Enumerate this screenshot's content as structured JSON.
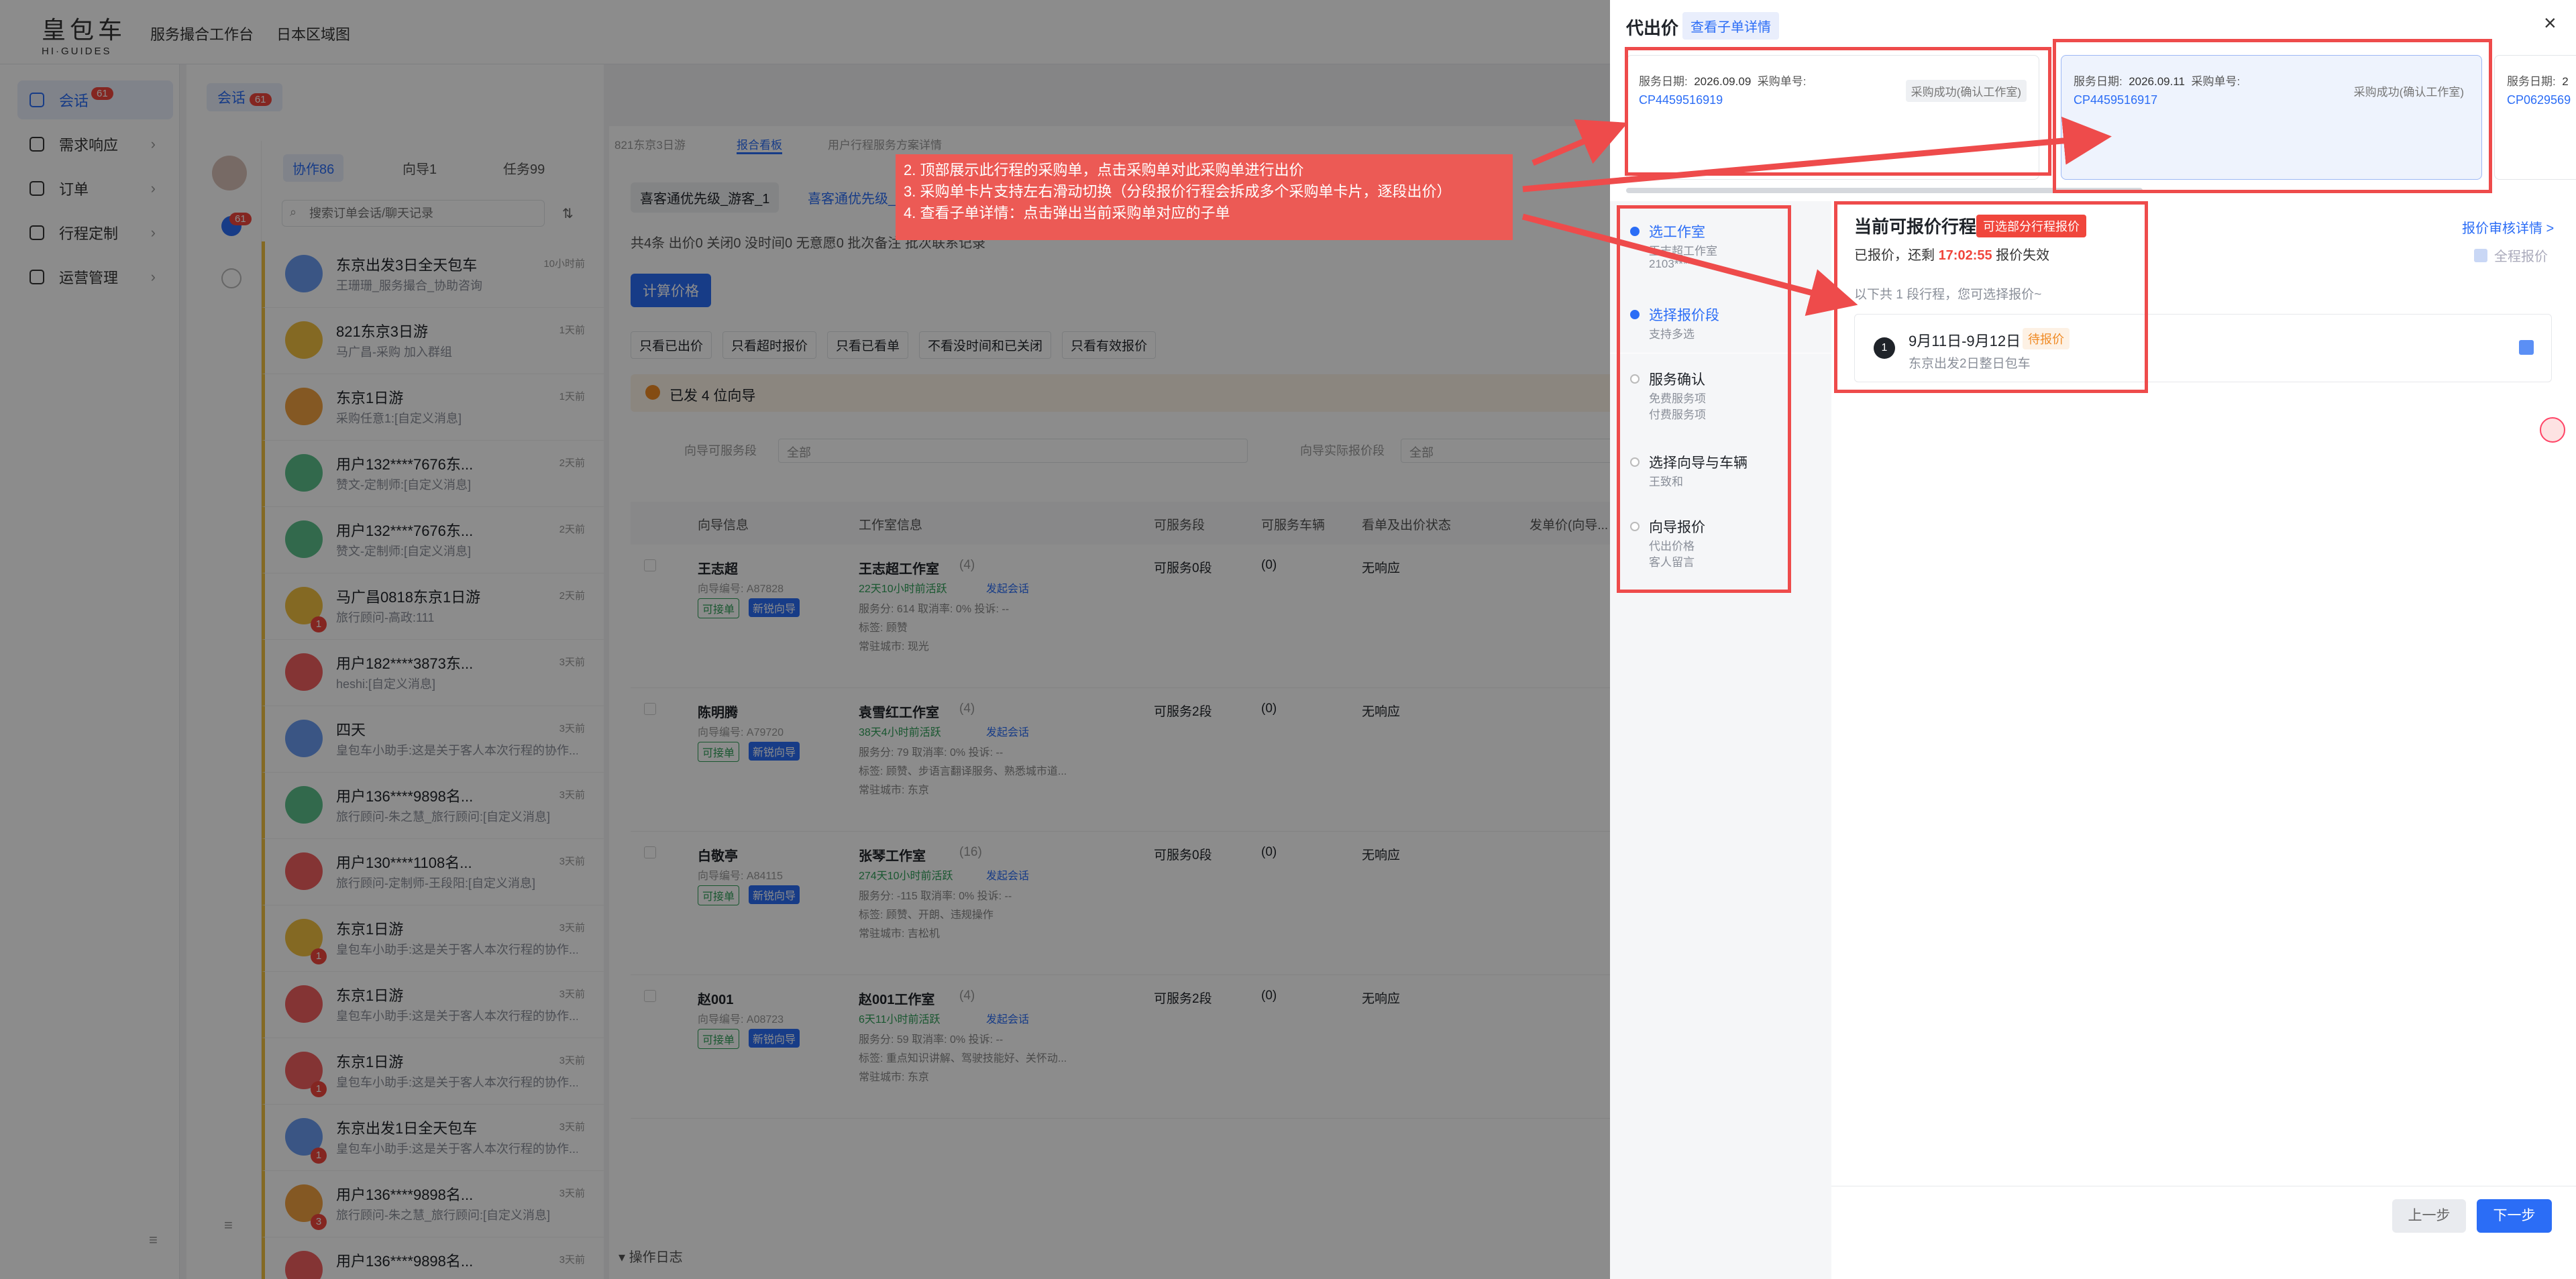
{
  "app": {
    "logo_cn": "皇包车",
    "logo_en": "HI·GUIDES",
    "top_nav": [
      "服务撮合工作台",
      "日本区域图"
    ]
  },
  "sidebar": {
    "items": [
      {
        "label": "会话",
        "badge": "61"
      },
      {
        "label": "需求响应"
      },
      {
        "label": "订单"
      },
      {
        "label": "行程定制"
      },
      {
        "label": "运营管理"
      }
    ]
  },
  "conversation": {
    "tab_label": "会话",
    "tab_badge": "61",
    "filters": [
      "协作86",
      "向导1",
      "任务99"
    ],
    "search_placeholder": "搜索订单会话/聊天记录",
    "rail_badge": "61",
    "chats": [
      {
        "name": "东京出发3日全天包车",
        "sub": "王珊珊_服务撮合_协助咨询",
        "time": "10小时前"
      },
      {
        "name": "821东京3日游",
        "sub": "马广昌-采购 加入群组",
        "time": "1天前"
      },
      {
        "name": "东京1日游",
        "sub": "采购任意1:[自定义消息]",
        "time": "1天前"
      },
      {
        "name": "用户132****7676东...",
        "sub": "赞文-定制师:[自定义消息]",
        "time": "2天前"
      },
      {
        "name": "用户132****7676东...",
        "sub": "赞文-定制师:[自定义消息]",
        "time": "2天前"
      },
      {
        "name": "马广昌0818东京1日游",
        "sub": "旅行顾问-高政:111",
        "time": "2天前",
        "badge": "1"
      },
      {
        "name": "用户182****3873东...",
        "sub": "heshi:[自定义消息]",
        "time": "3天前"
      },
      {
        "name": "四天",
        "sub": "皇包车小助手:这是关于客人本次行程的协作...",
        "time": "3天前"
      },
      {
        "name": "用户136****9898名...",
        "sub": "旅行顾问-朱之慧_旅行顾问:[自定义消息]",
        "time": "3天前"
      },
      {
        "name": "用户130****1108名...",
        "sub": "旅行顾问-定制师-王段阳:[自定义消息]",
        "time": "3天前"
      },
      {
        "name": "东京1日游",
        "sub": "皇包车小助手:这是关于客人本次行程的协作...",
        "time": "3天前",
        "badge": "1"
      },
      {
        "name": "东京1日游",
        "sub": "皇包车小助手:这是关于客人本次行程的协作...",
        "time": "3天前"
      },
      {
        "name": "东京1日游",
        "sub": "皇包车小助手:这是关于客人本次行程的协作...",
        "time": "3天前",
        "badge": "1"
      },
      {
        "name": "东京出发1日全天包车",
        "sub": "皇包车小助手:这是关于客人本次行程的协作...",
        "time": "3天前",
        "badge": "1"
      },
      {
        "name": "用户136****9898名...",
        "sub": "旅行顾问-朱之慧_旅行顾问:[自定义消息]",
        "time": "3天前",
        "badge": "3"
      },
      {
        "name": "用户136****9898名...",
        "sub": "",
        "time": "3天前"
      }
    ]
  },
  "main": {
    "breadcrumbs": [
      "821东京3日游",
      "报合看板",
      "用户行程服务方案详情"
    ],
    "tabs": [
      "喜客通优先级_游客_1",
      "喜客通优先级_1"
    ],
    "stats": "共4条  出价0  关闭0  没时间0  无意愿0  批次备注  批次联系记录",
    "calc_button": "计算价格",
    "filters": [
      "只看已出价",
      "只看超时报价",
      "只看已看单",
      "不看没时间和已关闭",
      "只看有效报价"
    ],
    "notice": "已发 4 位向导",
    "select_label_1": "向导可服务段",
    "select_value_1": "全部",
    "select_label_2": "向导实际报价段",
    "select_value_2": "全部",
    "columns": [
      "向导信息",
      "工作室信息",
      "可服务段",
      "可服务车辆",
      "看单及出价状态",
      "发单价(向导..."
    ],
    "rows": [
      {
        "guide": "王志超",
        "guide_no": "向导编号: A87828",
        "studio": "王志超工作室",
        "studio_count": "(4)",
        "online": "22天10小时前活跃",
        "chat": "发起会话",
        "stats": "服务分: 614  取消率: 0%  投诉: --",
        "tags": "标签: 顾赞",
        "city": "常驻城市: 现光",
        "segments": "可服务0段",
        "vehicles": "(0)",
        "status": "无响应"
      },
      {
        "guide": "陈明腾",
        "guide_no": "向导编号: A79720",
        "studio": "袁雪红工作室",
        "studio_count": "(4)",
        "online": "38天4小时前活跃",
        "chat": "发起会话",
        "stats": "服务分: 79  取消率: 0%  投诉: --",
        "tags": "标签: 顾赞、步语言翻译服务、熟悉城市道...",
        "city": "常驻城市: 东京",
        "segments": "可服务2段",
        "vehicles": "(0)",
        "status": "无响应"
      },
      {
        "guide": "白敬亭",
        "guide_no": "向导编号: A84115",
        "studio": "张琴工作室",
        "studio_count": "(16)",
        "online": "274天10小时前活跃",
        "chat": "发起会话",
        "stats": "服务分: -115  取消率: 0%  投诉: --",
        "tags": "标签: 顾赞、开朗、违规操作",
        "city": "常驻城市: 吉松机",
        "segments": "可服务0段",
        "vehicles": "(0)",
        "status": "无响应"
      },
      {
        "guide": "赵001",
        "guide_no": "向导编号: A08723",
        "studio": "赵001工作室",
        "studio_count": "(4)",
        "online": "6天11小时前活跃",
        "chat": "发起会话",
        "stats": "服务分: 59  取消率: 0%  投诉: --",
        "tags": "标签: 重点知识讲解、驾驶技能好、关怀动...",
        "city": "常驻城市: 东京",
        "segments": "可服务2段",
        "vehicles": "(0)",
        "status": "无响应"
      }
    ],
    "chip_accept": "可接单",
    "chip_new": "新锐向导",
    "log_label": "操作日志"
  },
  "drawer": {
    "title": "代出价",
    "sub_link": "查看子单详情",
    "purchase_cards": [
      {
        "date_label": "服务日期:",
        "date": "2026.09.09",
        "no_label": "采购单号:",
        "no": "CP4459516919",
        "status": "采购成功(确认工作室)"
      },
      {
        "date_label": "服务日期:",
        "date": "2026.09.11",
        "no_label": "采购单号:",
        "no": "CP4459516917",
        "status": "采购成功(确认工作室)"
      },
      {
        "date_label": "服务日期:",
        "date": "2",
        "no_label": "",
        "no": "CP0629569",
        "status": ""
      }
    ],
    "steps": [
      {
        "title": "选工作室",
        "subs": [
          "王志超工作室",
          "2103****"
        ]
      },
      {
        "title": "选择报价段",
        "subs": [
          "支持多选"
        ]
      },
      {
        "title": "服务确认",
        "subs": [
          "免费服务项",
          "付费服务项"
        ]
      },
      {
        "title": "选择向导与车辆",
        "subs": [
          "王致和"
        ]
      },
      {
        "title": "向导报价",
        "subs": [
          "代出价格",
          "客人留言"
        ]
      }
    ],
    "right": {
      "heading": "当前可报价行程",
      "tag": "可选部分行程报价",
      "link": "报价审核详情 >",
      "status_prefix": "已报价，还剩 ",
      "countdown": "17:02:55",
      "status_suffix": " 报价失效",
      "full_check": "全程报价",
      "note": "以下共 1 段行程，您可选择报价~",
      "segment": {
        "index": "1",
        "dates": "9月11日-9月12日",
        "pending": "待报价",
        "desc": "东京出发2日整日包车"
      }
    },
    "btn_prev": "上一步",
    "btn_next": "下一步"
  },
  "annotation": {
    "lines": [
      "2. 顶部展示此行程的采购单，点击采购单对此采购单进行出价",
      "3. 采购单卡片支持左右滑动切换（分段报价行程会拆成多个采购单卡片，逐段出价）",
      "4. 查看子单详情：点击弹出当前采购单对应的子单"
    ],
    "color": "#ee4b4b"
  },
  "colors": {
    "accent": "#2b6df6",
    "danger": "#f0463c",
    "annotation": "#ee4b4b"
  }
}
